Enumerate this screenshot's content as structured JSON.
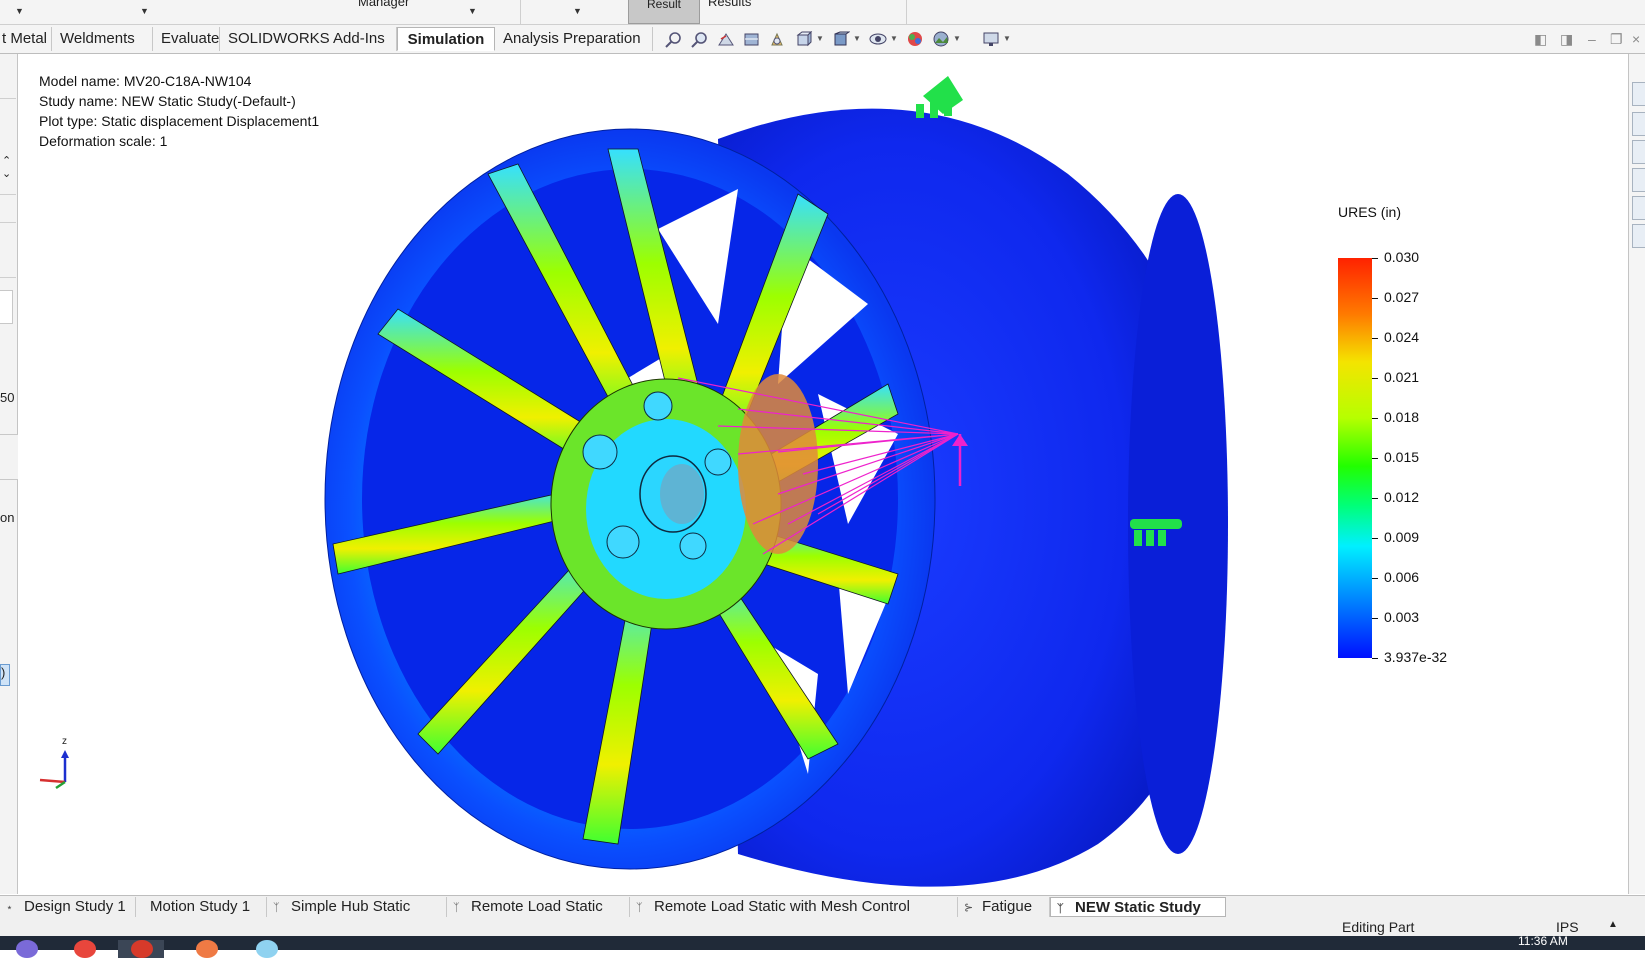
{
  "top_strip": {
    "manager_text": "Manager",
    "result_button": "Result",
    "results_label": "Results"
  },
  "tabs": [
    {
      "label": "t Metal",
      "active": false
    },
    {
      "label": "Weldments",
      "active": false
    },
    {
      "label": "Evaluate",
      "active": false
    },
    {
      "label": "SOLIDWORKS Add-Ins",
      "active": false
    },
    {
      "label": "Simulation",
      "active": true
    },
    {
      "label": "Analysis Preparation",
      "active": false
    }
  ],
  "view_toolbar_icons": [
    "zoom-to-fit-icon",
    "zoom-area-icon",
    "previous-view-icon",
    "section-view-icon",
    "dynamic-annotation-icon",
    "view-orientation-icon",
    "display-style-icon",
    "hide-show-icon",
    "edit-appearance-icon",
    "apply-scene-icon",
    "view-settings-icon"
  ],
  "left_panel": {
    "fragment_1": "50",
    "fragment_2": "on",
    "fragment_3": ")"
  },
  "info": {
    "model_name": "Model name: MV20-C18A-NW104",
    "study_name": "Study name: NEW Static Study(-Default-)",
    "plot_type": "Plot type: Static displacement Displacement1",
    "deformation_scale": "Deformation scale: 1"
  },
  "legend": {
    "title": "URES (in)",
    "labels": [
      "0.030",
      "0.027",
      "0.024",
      "0.021",
      "0.018",
      "0.015",
      "0.012",
      "0.009",
      "0.006",
      "0.003",
      "3.937e-32"
    ],
    "max_color": "#ff2200",
    "min_color": "#0010ff"
  },
  "triad": {
    "axis_label": "z"
  },
  "study_tabs": [
    {
      "label": "Design Study 1",
      "icon": "",
      "active": false
    },
    {
      "label": "Motion Study 1",
      "icon": "",
      "active": false
    },
    {
      "label": "Simple Hub Static",
      "icon": "static-study-icon",
      "active": false
    },
    {
      "label": "Remote Load Static",
      "icon": "static-study-icon",
      "active": false
    },
    {
      "label": "Remote Load Static with Mesh Control",
      "icon": "static-study-icon",
      "active": false
    },
    {
      "label": "Fatigue",
      "icon": "fatigue-study-icon",
      "active": false
    },
    {
      "label": "NEW Static Study",
      "icon": "static-study-icon",
      "active": true
    }
  ],
  "status": {
    "editing": "Editing Part",
    "units": "IPS"
  },
  "taskbar": {
    "clock": "11:36 AM"
  }
}
